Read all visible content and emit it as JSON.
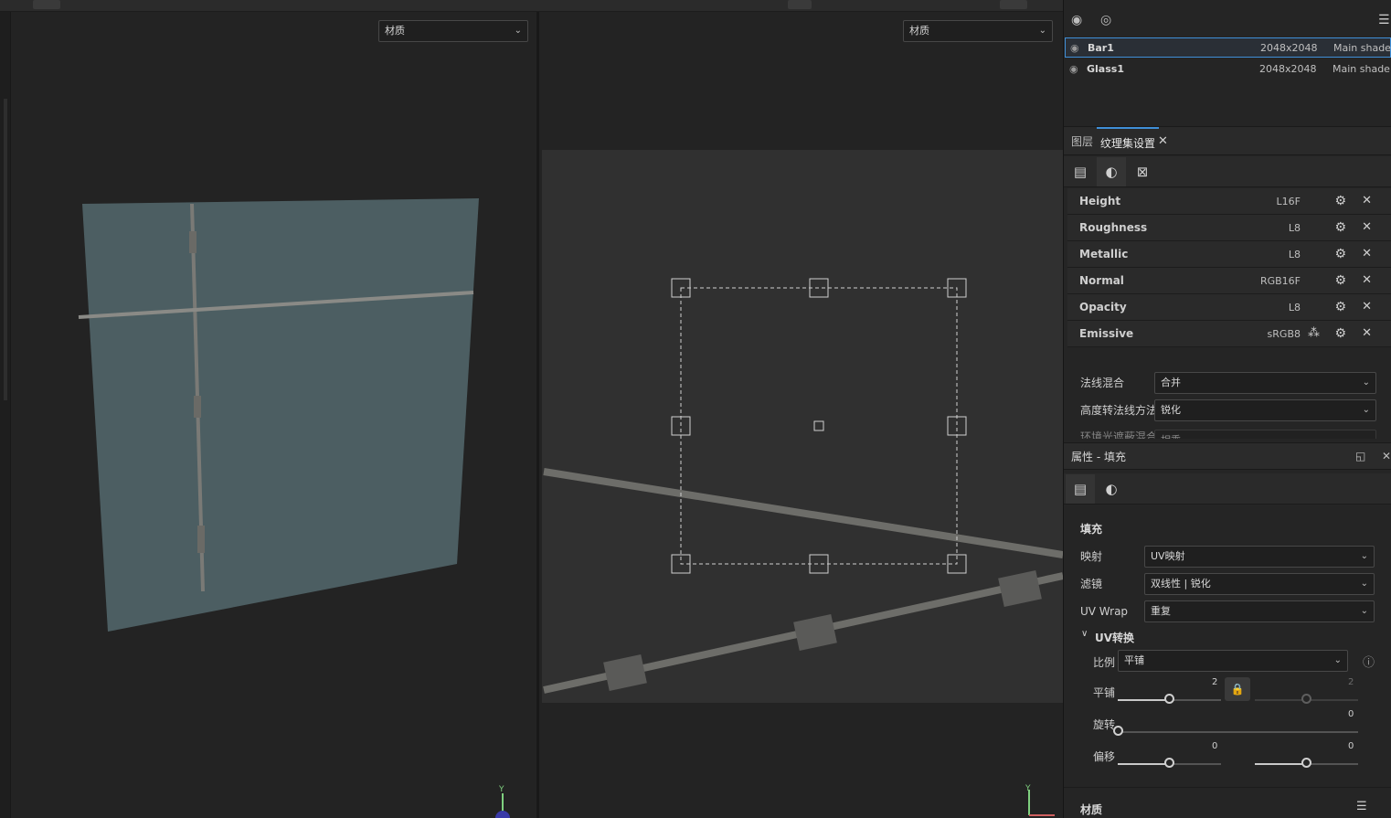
{
  "viewports": {
    "left_dropdown": "材质",
    "right_dropdown": "材质",
    "axis_y": "Y"
  },
  "texture_sets": [
    {
      "name": "Bar1",
      "size": "2048x2048",
      "shader": "Main shader",
      "selected": true
    },
    {
      "name": "Glass1",
      "size": "2048x2048",
      "shader": "Main shader",
      "selected": false
    }
  ],
  "tabs": {
    "layers": "图层",
    "texture_set_settings": "纹理集设置"
  },
  "channels": [
    {
      "name": "Height",
      "format": "L16F"
    },
    {
      "name": "Roughness",
      "format": "L8"
    },
    {
      "name": "Metallic",
      "format": "L8"
    },
    {
      "name": "Normal",
      "format": "RGB16F"
    },
    {
      "name": "Opacity",
      "format": "L8"
    },
    {
      "name": "Emissive",
      "format": "sRGB8"
    }
  ],
  "texture_set_props": {
    "normal_mix_label": "法线混合",
    "normal_mix_value": "合并",
    "height_to_normal_label": "高度转法线方法",
    "height_to_normal_value": "锐化",
    "ao_mix_label": "环境光遮蔽混合",
    "ao_mix_value": "相乘"
  },
  "properties": {
    "header": "属性 - 填充",
    "section_fill": "填充",
    "mapping_label": "映射",
    "mapping_value": "UV映射",
    "filter_label": "滤镜",
    "filter_value": "双线性 | 锐化",
    "uvwrap_label": "UV Wrap",
    "uvwrap_value": "重复",
    "uv_transform": "UV转换",
    "scale_label": "比例",
    "scale_value": "平铺",
    "tiling_label": "平铺",
    "tiling_u": "2",
    "tiling_v": "2",
    "rotation_label": "旋转",
    "rotation_value": "0",
    "offset_label": "偏移",
    "offset_u": "0",
    "offset_v": "0",
    "section_material": "材质"
  },
  "sliders": {
    "tiling_u_fraction": 0.5,
    "tiling_v_fraction": 0.5,
    "rotation_fraction": 0.0,
    "offset_u_fraction": 0.5,
    "offset_v_fraction": 0.5
  }
}
